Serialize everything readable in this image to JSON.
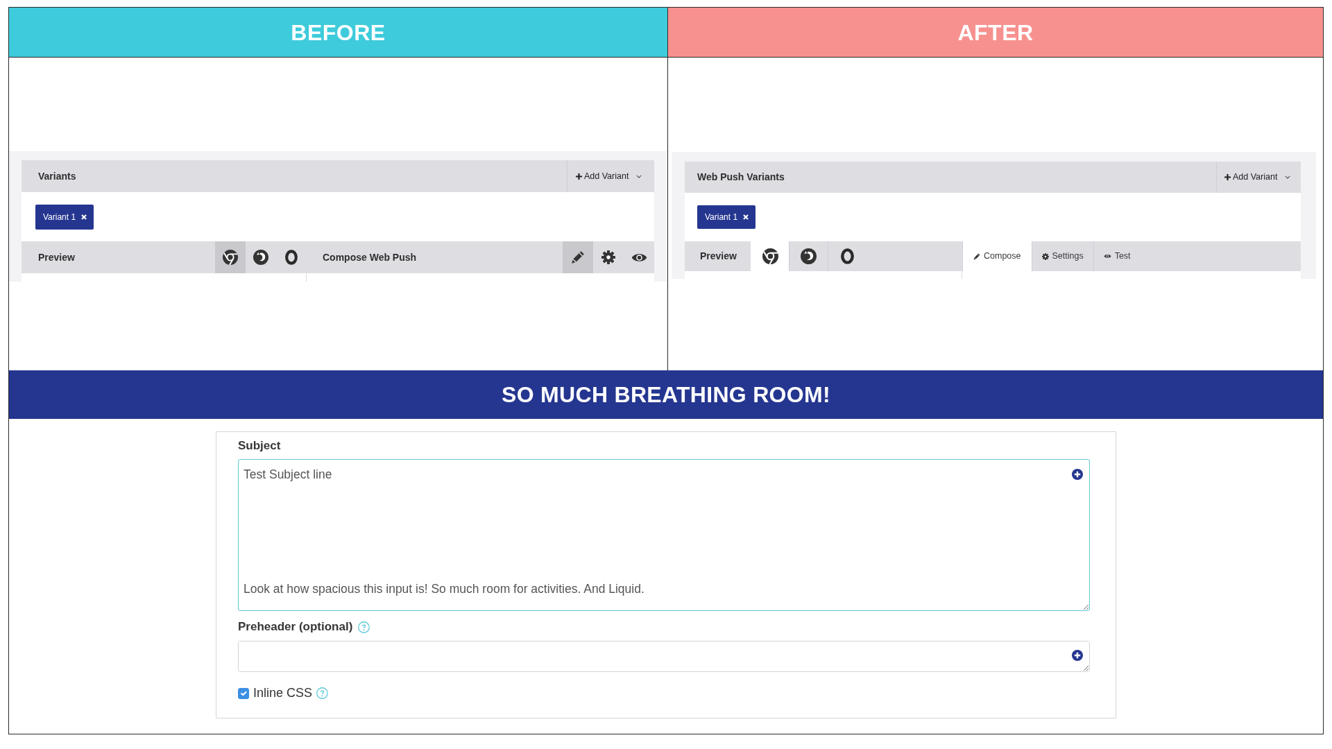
{
  "panels": [
    {
      "heading": "BEFORE",
      "color": "#3ecbdb",
      "title": "Variants",
      "add_button": "Add Variant",
      "variants": [
        "Variant 1"
      ],
      "preview": {
        "label": "Preview",
        "browsers": [
          {
            "kind": "chrome",
            "selected": true
          },
          {
            "kind": "firefox",
            "selected": false
          },
          {
            "kind": "opera",
            "selected": false
          }
        ]
      },
      "compose": {
        "kind": "toolbar",
        "title": "Compose Web Push",
        "tools": [
          {
            "kind": "compose",
            "selected": true
          },
          {
            "kind": "settings",
            "selected": false
          },
          {
            "kind": "test",
            "selected": false
          }
        ]
      }
    },
    {
      "heading": "AFTER",
      "color": "#f7918f",
      "title": "Web Push Variants",
      "add_button": "Add Variant",
      "variants": [
        "Variant 1"
      ],
      "preview": {
        "label": "Preview",
        "browsers": [
          {
            "kind": "chrome",
            "selected": true
          },
          {
            "kind": "firefox",
            "selected": false
          },
          {
            "kind": "opera",
            "selected": false
          }
        ]
      },
      "compose": {
        "kind": "tabs",
        "tabs": [
          {
            "kind": "compose",
            "label": "Compose",
            "selected": true
          },
          {
            "kind": "settings",
            "label": "Settings",
            "selected": false
          },
          {
            "kind": "test",
            "label": "Test",
            "selected": false
          }
        ]
      }
    }
  ],
  "caption": "SO MUCH BREATHING ROOM!",
  "form": {
    "subject": {
      "label": "Subject",
      "value": "Test Subject line\n\n\n\n\n\nLook at how spacious this input is! So much room for activities. And Liquid.",
      "focused": true
    },
    "preheader": {
      "label": "Preheader (optional)",
      "focused": false,
      "help": true
    },
    "inline_css": {
      "label": "Inline CSS",
      "checked": true,
      "help": true
    }
  }
}
